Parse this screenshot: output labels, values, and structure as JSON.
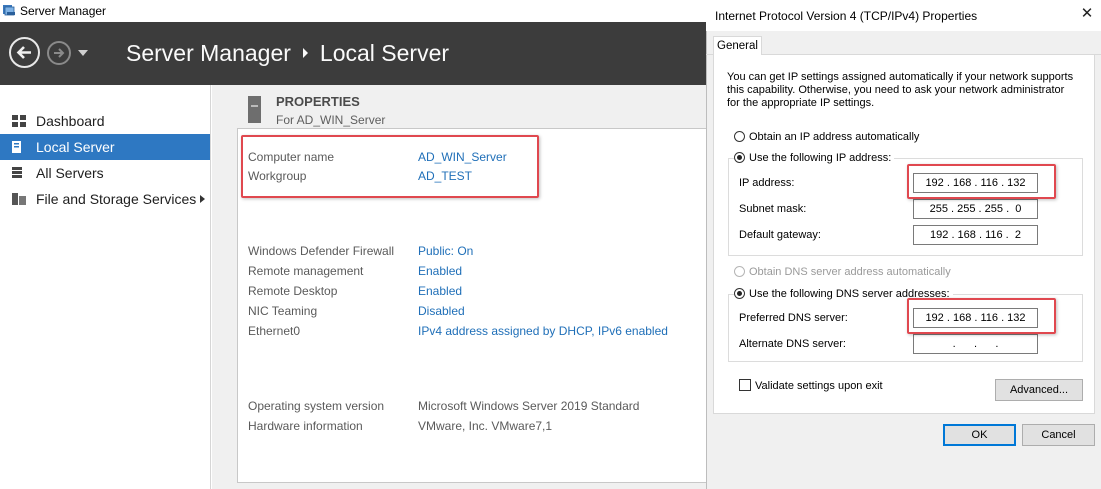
{
  "server_manager": {
    "window_title": "Server Manager",
    "header": {
      "app": "Server Manager",
      "page": "Local Server"
    },
    "nav": {
      "items": [
        {
          "label": "Dashboard",
          "icon": "dashboard-icon"
        },
        {
          "label": "Local Server",
          "icon": "local-server-icon",
          "active": true
        },
        {
          "label": "All Servers",
          "icon": "all-servers-icon"
        },
        {
          "label": "File and Storage Services",
          "icon": "file-storage-icon",
          "has_submenu": true
        }
      ]
    },
    "properties": {
      "title": "PROPERTIES",
      "subtitle": "For AD_WIN_Server",
      "identity": [
        {
          "key": "Computer name",
          "value": "AD_WIN_Server"
        },
        {
          "key": "Workgroup",
          "value": "AD_TEST"
        }
      ],
      "status": [
        {
          "key": "Windows Defender Firewall",
          "value": "Public: On"
        },
        {
          "key": "Remote management",
          "value": "Enabled"
        },
        {
          "key": "Remote Desktop",
          "value": "Enabled"
        },
        {
          "key": "NIC Teaming",
          "value": "Disabled"
        },
        {
          "key": "Ethernet0",
          "value": "IPv4 address assigned by DHCP, IPv6 enabled"
        }
      ],
      "system": [
        {
          "key": "Operating system version",
          "value": "Microsoft Windows Server 2019 Standard"
        },
        {
          "key": "Hardware information",
          "value": "VMware, Inc. VMware7,1"
        }
      ]
    }
  },
  "dialog": {
    "title": "Internet Protocol Version 4 (TCP/IPv4) Properties",
    "close": "✕",
    "tab": "General",
    "intro": "You can get IP settings assigned automatically if your network supports this capability. Otherwise, you need to ask your network administrator for the appropriate IP settings.",
    "ip_auto": "Obtain an IP address automatically",
    "ip_manual": "Use the following IP address:",
    "ip_address_label": "IP address:",
    "ip_address": "192 . 168 . 116 . 132",
    "subnet_label": "Subnet mask:",
    "subnet": "255 . 255 . 255 .  0",
    "gateway_label": "Default gateway:",
    "gateway": "192 . 168 . 116 .  2",
    "dns_auto": "Obtain DNS server address automatically",
    "dns_manual": "Use the following DNS server addresses:",
    "preferred_dns_label": "Preferred DNS server:",
    "preferred_dns": "192 . 168 . 116 . 132",
    "alternate_dns_label": "Alternate DNS server:",
    "alternate_dns": " .      .      . ",
    "validate": "Validate settings upon exit",
    "advanced": "Advanced...",
    "ok": "OK",
    "cancel": "Cancel"
  },
  "colors": {
    "header_bg": "#3c3c3c",
    "nav_active": "#2e78c2",
    "link": "#1f6fb8",
    "highlight": "#e0484f"
  }
}
